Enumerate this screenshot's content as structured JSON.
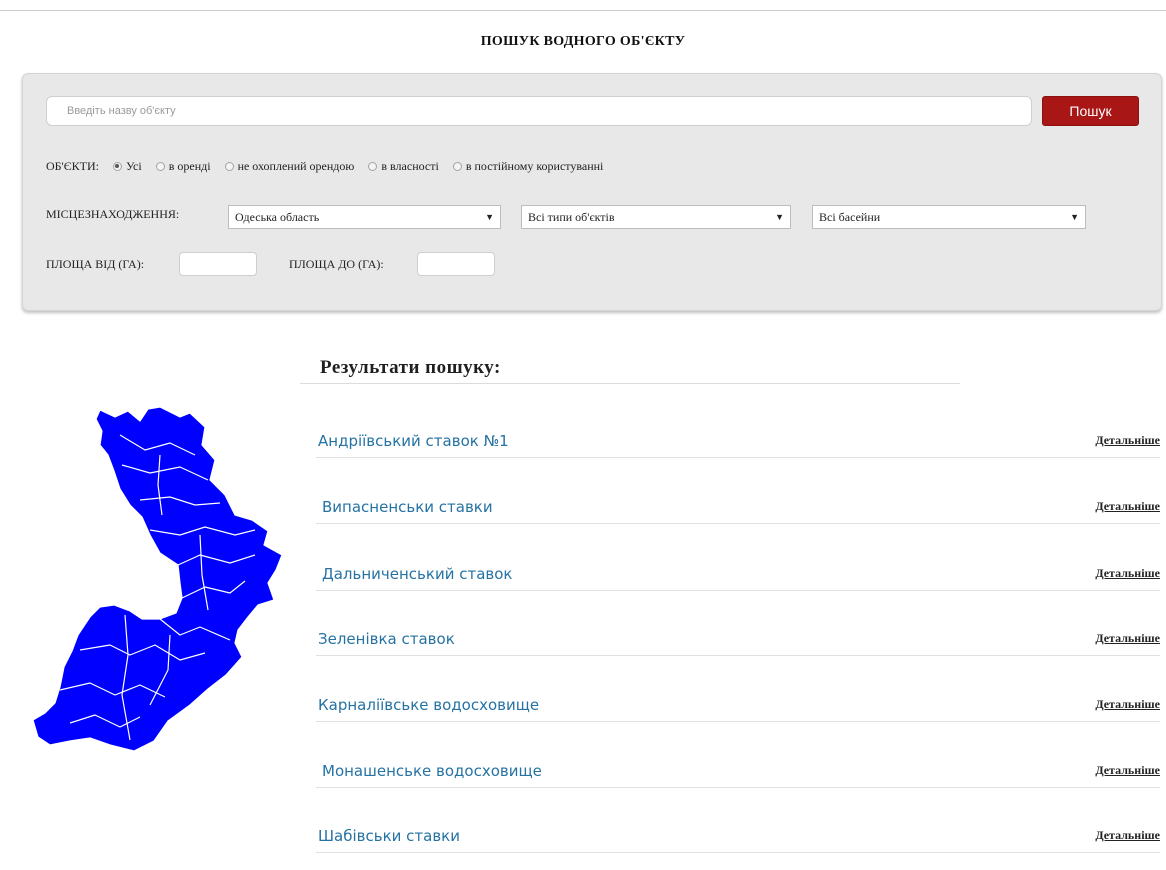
{
  "page": {
    "title": "ПОШУК ВОДНОГО ОБ'ЄКТУ"
  },
  "search": {
    "placeholder": "Введіть назву об'єкту",
    "value": "",
    "button_label": "Пошук",
    "button_color": "#a81616"
  },
  "filters": {
    "objects_label": "ОБ'ЄКТИ:",
    "object_options": [
      {
        "label": "Усі",
        "checked": true
      },
      {
        "label": "в оренді",
        "checked": false
      },
      {
        "label": "не охоплений орендою",
        "checked": false
      },
      {
        "label": "в власності",
        "checked": false
      },
      {
        "label": "в постійному користуванні",
        "checked": false
      }
    ],
    "location_label": "МІСЦЕЗНАХОДЖЕННЯ:",
    "region_selected": "Одеська область",
    "type_selected": "Всі типи об'єктів",
    "basin_selected": "Всі басейни",
    "area_from_label": "ПЛОЩА ВІД (ГА):",
    "area_to_label": "ПЛОЩА ДО (ГА):",
    "area_from_value": "",
    "area_to_value": ""
  },
  "map": {
    "icon": "region-map-odesa",
    "fill_color": "#0000ff"
  },
  "results": {
    "title": "Результати пошуку:",
    "link_color": "#2572a3",
    "items": [
      {
        "name": "Андріївський ставок №1",
        "more": "Детальніше"
      },
      {
        "name": "Випасненськи ставки",
        "more": "Детальніше"
      },
      {
        "name": "Дальниченський ставок",
        "more": "Детальніше"
      },
      {
        "name": "Зеленівка ставок",
        "more": "Детальніше"
      },
      {
        "name": "Карналіївське водосховище",
        "more": "Детальніше"
      },
      {
        "name": "Монашенське водосховище",
        "more": "Детальніше"
      },
      {
        "name": "Шабівськи ставки",
        "more": "Детальніше"
      }
    ]
  }
}
